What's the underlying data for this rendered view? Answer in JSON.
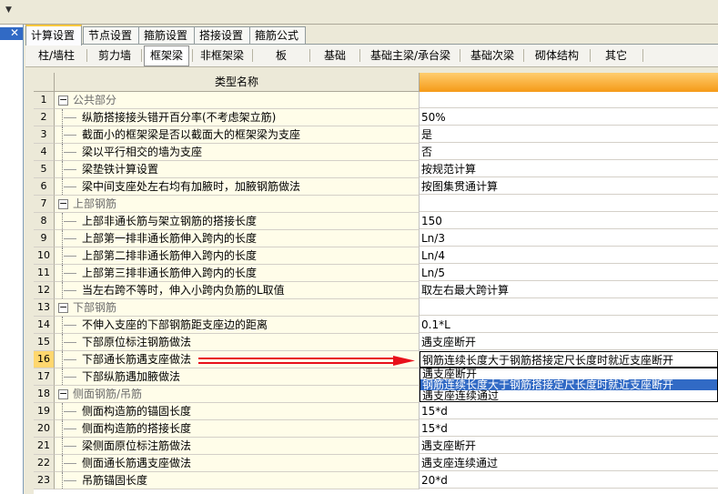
{
  "tabs_primary": [
    {
      "label": "计算设置",
      "active": true
    },
    {
      "label": "节点设置",
      "active": false
    },
    {
      "label": "箍筋设置",
      "active": false
    },
    {
      "label": "搭接设置",
      "active": false
    },
    {
      "label": "箍筋公式",
      "active": false
    }
  ],
  "tabs_secondary": [
    {
      "label": "柱/墙柱",
      "active": false
    },
    {
      "label": "剪力墙",
      "active": false
    },
    {
      "label": "框架梁",
      "active": true
    },
    {
      "label": "非框架梁",
      "active": false
    },
    {
      "label": "板",
      "active": false
    },
    {
      "label": "基础",
      "active": false
    },
    {
      "label": "基础主梁/承台梁",
      "active": false
    },
    {
      "label": "基础次梁",
      "active": false
    },
    {
      "label": "砌体结构",
      "active": false
    },
    {
      "label": "其它",
      "active": false
    }
  ],
  "grid": {
    "header_name": "类型名称",
    "rows": [
      {
        "num": "1",
        "name": "公共部分",
        "value": "",
        "group": true
      },
      {
        "num": "2",
        "name": "纵筋搭接接头错开百分率(不考虑架立筋)",
        "value": "50%"
      },
      {
        "num": "3",
        "name": "截面小的框架梁是否以截面大的框架梁为支座",
        "value": "是"
      },
      {
        "num": "4",
        "name": "梁以平行相交的墙为支座",
        "value": "否"
      },
      {
        "num": "5",
        "name": "梁垫铁计算设置",
        "value": "按规范计算"
      },
      {
        "num": "6",
        "name": "梁中间支座处左右均有加腋时，加腋钢筋做法",
        "value": "按图集贯通计算"
      },
      {
        "num": "7",
        "name": "上部钢筋",
        "value": "",
        "group": true
      },
      {
        "num": "8",
        "name": "上部非通长筋与架立钢筋的搭接长度",
        "value": "150"
      },
      {
        "num": "9",
        "name": "上部第一排非通长筋伸入跨内的长度",
        "value": "Ln/3"
      },
      {
        "num": "10",
        "name": "上部第二排非通长筋伸入跨内的长度",
        "value": "Ln/4"
      },
      {
        "num": "11",
        "name": "上部第三排非通长筋伸入跨内的长度",
        "value": "Ln/5"
      },
      {
        "num": "12",
        "name": "当左右跨不等时，伸入小跨内负筋的L取值",
        "value": "取左右最大跨计算"
      },
      {
        "num": "13",
        "name": "下部钢筋",
        "value": "",
        "group": true
      },
      {
        "num": "14",
        "name": "不伸入支座的下部钢筋距支座边的距离",
        "value": "0.1*L"
      },
      {
        "num": "15",
        "name": "下部原位标注钢筋做法",
        "value": "遇支座断开"
      },
      {
        "num": "16",
        "name": "下部通长筋遇支座做法",
        "value": "钢筋连续长度大于钢筋搭接定尺长度时就近支座断开",
        "selected": true
      },
      {
        "num": "17",
        "name": "下部纵筋遇加腋做法",
        "value": ""
      },
      {
        "num": "18",
        "name": "侧面钢筋/吊筋",
        "value": "",
        "group": true
      },
      {
        "num": "19",
        "name": "侧面构造筋的锚固长度",
        "value": "15*d"
      },
      {
        "num": "20",
        "name": "侧面构造筋的搭接长度",
        "value": "15*d"
      },
      {
        "num": "21",
        "name": "梁侧面原位标注筋做法",
        "value": "遇支座断开"
      },
      {
        "num": "22",
        "name": "侧面通长筋遇支座做法",
        "value": "遇支座连续通过"
      },
      {
        "num": "23",
        "name": "吊筋锚固长度",
        "value": "20*d"
      }
    ]
  },
  "dropdown": {
    "options": [
      {
        "label": "遇支座断开",
        "highlighted": false
      },
      {
        "label": "钢筋连续长度大于钢筋搭接定尺长度时就近支座断开",
        "highlighted": true
      },
      {
        "label": "遇支座连续通过",
        "highlighted": false
      }
    ]
  },
  "colors": {
    "arrow": "#e8101a",
    "highlight": "#316ac5",
    "header_gradient_top": "#ffcd6e",
    "header_gradient_bottom": "#f59a18"
  }
}
